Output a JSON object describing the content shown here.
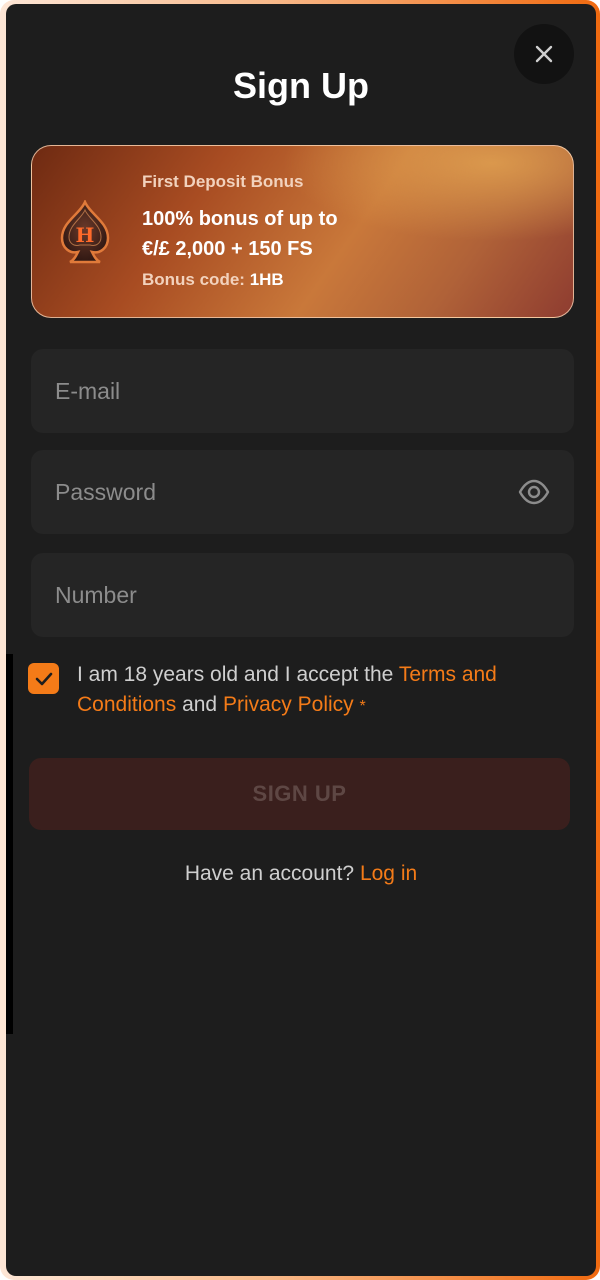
{
  "modal": {
    "title": "Sign Up",
    "close_label": "×"
  },
  "bonus": {
    "heading": "First Deposit Bonus",
    "offer_line1": "100% bonus of up to",
    "offer_line2": "€/£ 2,000 + 150 FS",
    "code_label": "Bonus code:",
    "code_value": "1HB",
    "icon": "spade-h-logo-icon"
  },
  "form": {
    "email": {
      "placeholder": "E-mail",
      "value": ""
    },
    "password": {
      "placeholder": "Password",
      "value": "",
      "icon": "eye-icon"
    },
    "number": {
      "placeholder": "Number",
      "value": ""
    }
  },
  "terms": {
    "checked": true,
    "text_before": "I am 18 years old and I accept the ",
    "terms_link": "Terms and Conditions",
    "text_middle": " and ",
    "privacy_link": "Privacy Policy",
    "asterisk": "*"
  },
  "actions": {
    "signup_label": "SIGN UP",
    "have_account": "Have an account?",
    "login_link": "Log in"
  },
  "colors": {
    "accent": "#f47b18",
    "background": "#1d1d1d",
    "field": "#252525",
    "signup_disabled": "#3a1f1d"
  }
}
